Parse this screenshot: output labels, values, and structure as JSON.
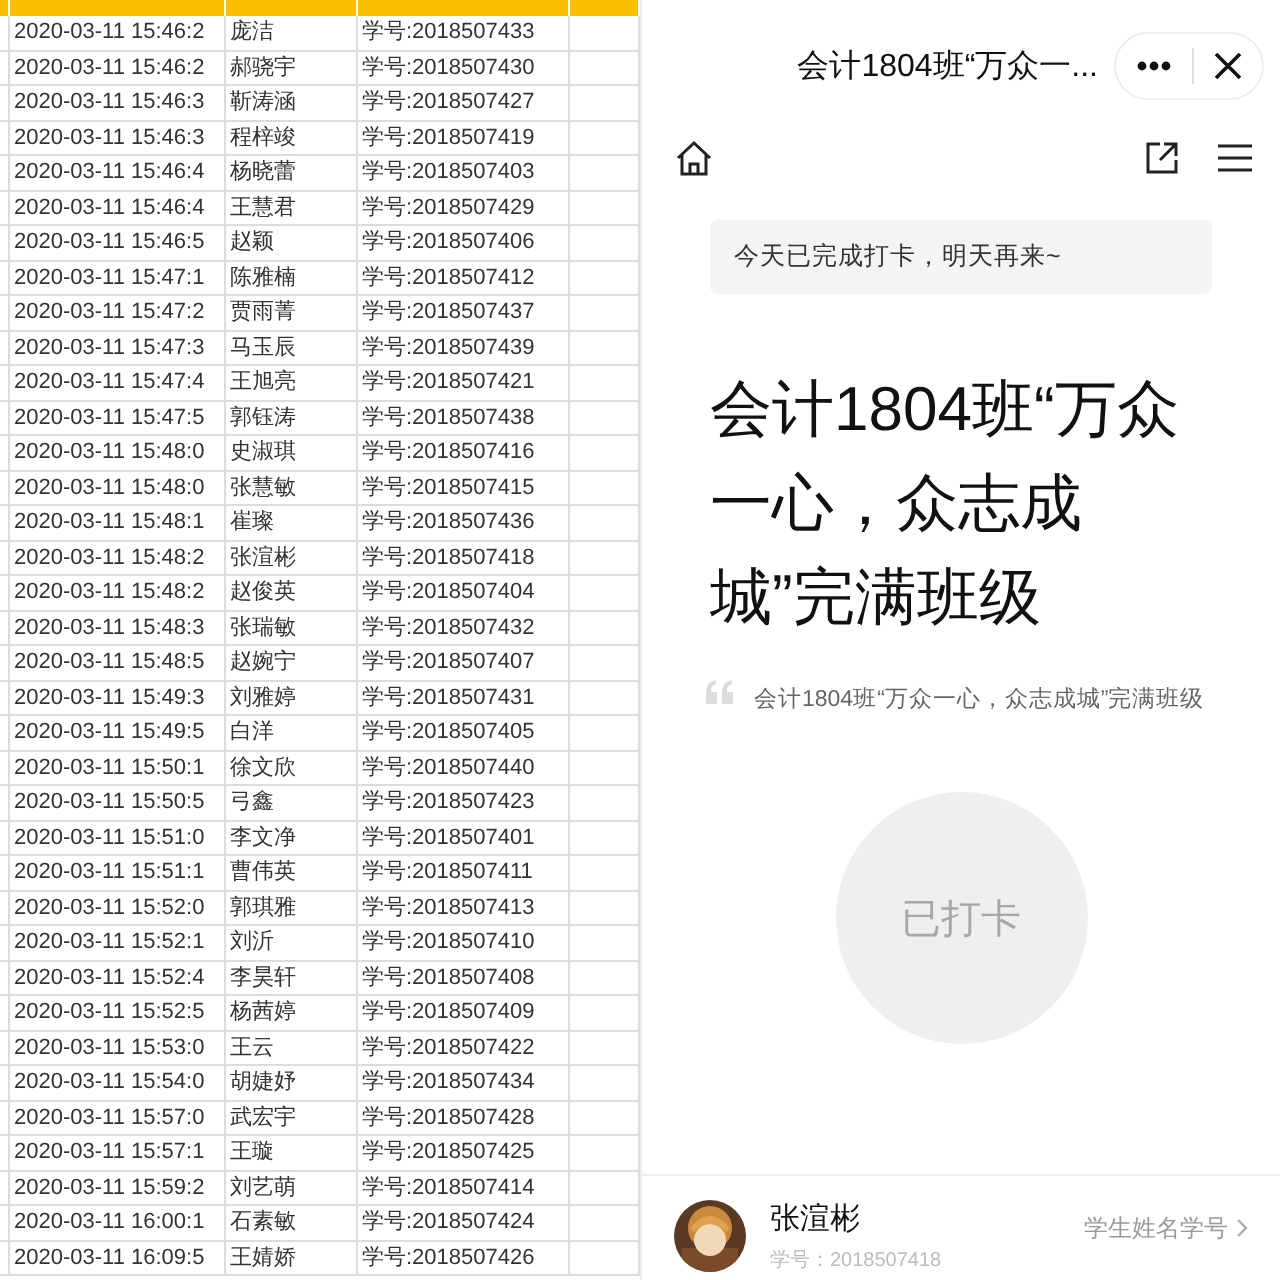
{
  "sheet": {
    "rows": [
      {
        "time": "2020-03-11 15:46:2",
        "name": "庞洁",
        "id": "学号:2018507433"
      },
      {
        "time": "2020-03-11 15:46:2",
        "name": "郝骁宇",
        "id": "学号:2018507430"
      },
      {
        "time": "2020-03-11 15:46:3",
        "name": "靳涛涵",
        "id": "学号:2018507427"
      },
      {
        "time": "2020-03-11 15:46:3",
        "name": "程梓竣",
        "id": "学号:2018507419"
      },
      {
        "time": "2020-03-11 15:46:4",
        "name": "杨晓蕾",
        "id": "学号:2018507403"
      },
      {
        "time": "2020-03-11 15:46:4",
        "name": "王慧君",
        "id": "学号:2018507429"
      },
      {
        "time": "2020-03-11 15:46:5",
        "name": "赵颖",
        "id": "学号:2018507406"
      },
      {
        "time": "2020-03-11 15:47:1",
        "name": "陈雅楠",
        "id": "学号:2018507412"
      },
      {
        "time": "2020-03-11 15:47:2",
        "name": "贾雨菁",
        "id": "学号:2018507437"
      },
      {
        "time": "2020-03-11 15:47:3",
        "name": "马玉辰",
        "id": "学号:2018507439"
      },
      {
        "time": "2020-03-11 15:47:4",
        "name": "王旭亮",
        "id": "学号:2018507421"
      },
      {
        "time": "2020-03-11 15:47:5",
        "name": "郭钰涛",
        "id": "学号:2018507438"
      },
      {
        "time": "2020-03-11 15:48:0",
        "name": "史淑琪",
        "id": "学号:2018507416"
      },
      {
        "time": "2020-03-11 15:48:0",
        "name": "张慧敏",
        "id": "学号:2018507415"
      },
      {
        "time": "2020-03-11 15:48:1",
        "name": "崔璨",
        "id": "学号:2018507436"
      },
      {
        "time": "2020-03-11 15:48:2",
        "name": "张渲彬",
        "id": "学号:2018507418"
      },
      {
        "time": "2020-03-11 15:48:2",
        "name": "赵俊英",
        "id": "学号:2018507404"
      },
      {
        "time": "2020-03-11 15:48:3",
        "name": "张瑞敏",
        "id": "学号:2018507432"
      },
      {
        "time": "2020-03-11 15:48:5",
        "name": "赵婉宁",
        "id": "学号:2018507407"
      },
      {
        "time": "2020-03-11 15:49:3",
        "name": "刘雅婷",
        "id": "学号:2018507431"
      },
      {
        "time": "2020-03-11 15:49:5",
        "name": "白洋",
        "id": "学号:2018507405"
      },
      {
        "time": "2020-03-11 15:50:1",
        "name": "徐文欣",
        "id": "学号:2018507440"
      },
      {
        "time": "2020-03-11 15:50:5",
        "name": "弓鑫",
        "id": "学号:2018507423"
      },
      {
        "time": "2020-03-11 15:51:0",
        "name": "李文净",
        "id": "学号:2018507401"
      },
      {
        "time": "2020-03-11 15:51:1",
        "name": "曹伟英",
        "id": "学号:2018507411"
      },
      {
        "time": "2020-03-11 15:52:0",
        "name": "郭琪雅",
        "id": "学号:2018507413"
      },
      {
        "time": "2020-03-11 15:52:1",
        "name": "刘沂",
        "id": "学号:2018507410"
      },
      {
        "time": "2020-03-11 15:52:4",
        "name": "李昊轩",
        "id": "学号:2018507408"
      },
      {
        "time": "2020-03-11 15:52:5",
        "name": "杨茜婷",
        "id": "学号:2018507409"
      },
      {
        "time": "2020-03-11 15:53:0",
        "name": "王云",
        "id": "学号:2018507422"
      },
      {
        "time": "2020-03-11 15:54:0",
        "name": "胡婕妤",
        "id": "学号:2018507434"
      },
      {
        "time": "2020-03-11 15:57:0",
        "name": "武宏宇",
        "id": "学号:2018507428"
      },
      {
        "time": "2020-03-11 15:57:1",
        "name": "王璇",
        "id": "学号:2018507425"
      },
      {
        "time": "2020-03-11 15:59:2",
        "name": "刘艺萌",
        "id": "学号:2018507414"
      },
      {
        "time": "2020-03-11 16:00:1",
        "name": "石素敏",
        "id": "学号:2018507424"
      },
      {
        "time": "2020-03-11 16:09:5",
        "name": "王婧娇",
        "id": "学号:2018507426"
      }
    ]
  },
  "phone": {
    "title": "会计1804班“万众一...",
    "notice": "今天已完成打卡，明天再来~",
    "heading": "会计1804班“万众一心，众志成城”完满班级",
    "quote": "会计1804班“万众一心，众志成城”完满班级",
    "checkin_button": {
      "label": "已打卡",
      "disabled": true
    },
    "user": {
      "name": "张渲彬",
      "student_id": "学号：2018507418",
      "field_label": "学生姓名学号"
    }
  }
}
